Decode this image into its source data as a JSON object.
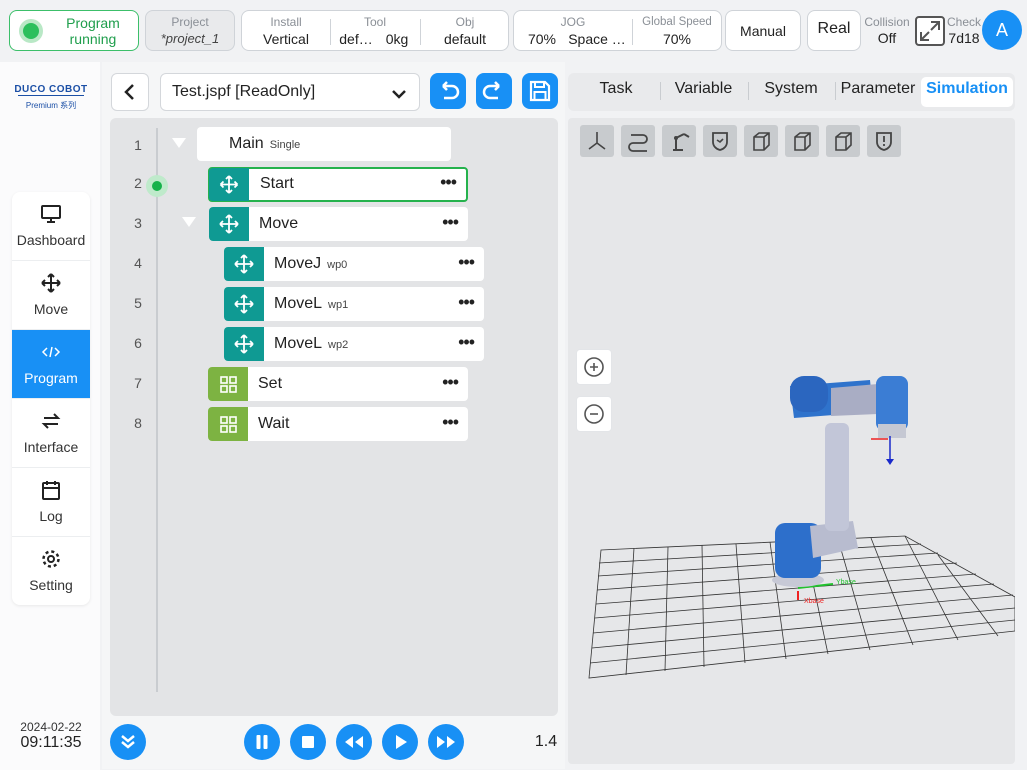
{
  "topbar": {
    "status": {
      "line1": "Program",
      "line2": "running"
    },
    "project": {
      "label": "Project",
      "value": "*project_1"
    },
    "install": {
      "label": "Install",
      "value": "Vertical"
    },
    "tool": {
      "label": "Tool",
      "value1": "def…",
      "value2": "0kg"
    },
    "obj": {
      "label": "Obj",
      "value": "default"
    },
    "jog": {
      "label": "JOG",
      "value1": "70%",
      "value2": "Space …"
    },
    "global_speed": {
      "label": "Global Speed",
      "value": "70%"
    },
    "manual_label": "Manual",
    "real_label": "Real",
    "collision": {
      "label": "Collision",
      "value": "Off"
    },
    "check": {
      "label": "Check",
      "value": "7d18"
    },
    "avatar_letter": "A"
  },
  "logo": {
    "brand": "DUCO COBOT",
    "sub": "Premium 系列"
  },
  "sidebar": {
    "items": [
      {
        "label": "Dashboard",
        "icon": "monitor-icon"
      },
      {
        "label": "Move",
        "icon": "move-arrows-icon"
      },
      {
        "label": "Program",
        "icon": "code-icon"
      },
      {
        "label": "Interface",
        "icon": "swap-icon"
      },
      {
        "label": "Log",
        "icon": "calendar-icon"
      },
      {
        "label": "Setting",
        "icon": "gear-icon"
      }
    ],
    "active": "Program"
  },
  "datetime": {
    "date": "2024-02-22",
    "time": "09:11:35"
  },
  "program": {
    "file_name": "Test.jspf [ReadOnly]",
    "lines": [
      {
        "num": "1",
        "name": "Main",
        "sub": "Single"
      },
      {
        "num": "2",
        "name": "Start",
        "sub": ""
      },
      {
        "num": "3",
        "name": "Move",
        "sub": ""
      },
      {
        "num": "4",
        "name": "MoveJ",
        "sub": "wp0"
      },
      {
        "num": "5",
        "name": "MoveL",
        "sub": "wp1"
      },
      {
        "num": "6",
        "name": "MoveL",
        "sub": "wp2"
      },
      {
        "num": "7",
        "name": "Set",
        "sub": ""
      },
      {
        "num": "8",
        "name": "Wait",
        "sub": ""
      }
    ],
    "more_glyph": "•••",
    "speed_value": "1.4"
  },
  "tabs": [
    "Task",
    "Variable",
    "System",
    "Parameter",
    "Simulation"
  ],
  "active_tab": "Simulation",
  "simulation": {
    "axis_labels": {
      "x": "Xbase",
      "y": "Ybase"
    }
  },
  "colors": {
    "accent": "#1890f5",
    "teal": "#0f9a93",
    "olive": "#7db342",
    "running": "#2bbf5c"
  }
}
